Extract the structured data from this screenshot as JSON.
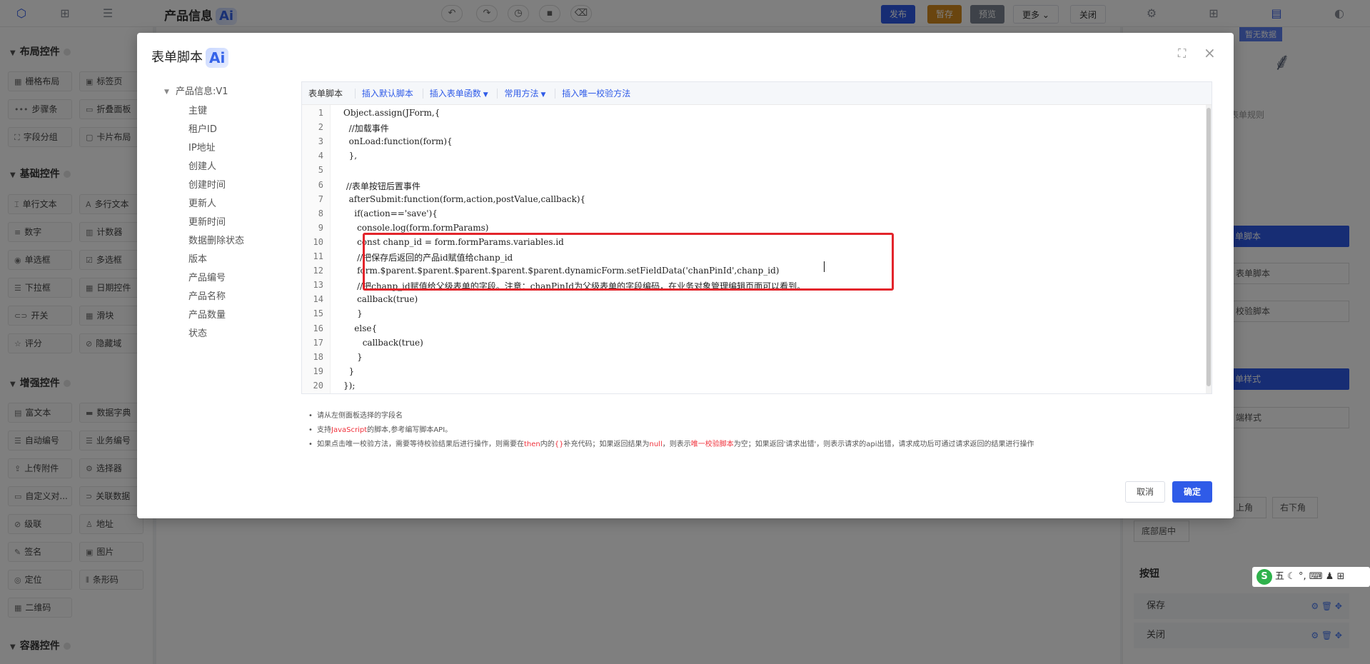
{
  "header": {
    "title": "产品信息",
    "ai_badge": "Ai",
    "actions": {
      "publish": "发布",
      "save_draft": "暂存",
      "preview": "预览",
      "more": "更多",
      "close": "关闭"
    }
  },
  "left_panel": {
    "sections": [
      {
        "title": "布局控件",
        "items": [
          "栅格布局",
          "标签页",
          "步骤条",
          "折叠面板",
          "字段分组",
          "卡片布局"
        ]
      },
      {
        "title": "基础控件",
        "items": [
          "单行文本",
          "多行文本",
          "数字",
          "计数器",
          "单选框",
          "多选框",
          "下拉框",
          "日期控件",
          "开关",
          "滑块",
          "评分",
          "隐藏域"
        ]
      },
      {
        "title": "增强控件",
        "items": [
          "富文本",
          "数据字典",
          "自动编号",
          "业务编号",
          "上传附件",
          "选择器",
          "自定义对...",
          "关联数据",
          "级联",
          "地址",
          "签名",
          "图片",
          "定位",
          "条形码",
          "二维码"
        ]
      },
      {
        "title": "容器控件",
        "items": []
      }
    ]
  },
  "right_panel": {
    "no_data": "暂无数据",
    "form_rules": "表单规则",
    "blue_buttons": [
      "单脚本",
      "单样式"
    ],
    "boxes": [
      "表单脚本",
      "校验脚本",
      "端样式"
    ],
    "position_buttons": [
      "上角",
      "右下角",
      "底部居中"
    ],
    "buttons_label": "按钮",
    "button_rows": [
      "保存",
      "关闭"
    ]
  },
  "modal": {
    "title": "表单脚本",
    "ai_badge": "Ai",
    "tree": {
      "root": "产品信息:V1",
      "fields": [
        "主键",
        "租户ID",
        "IP地址",
        "创建人",
        "创建时间",
        "更新人",
        "更新时间",
        "数据删除状态",
        "版本",
        "产品编号",
        "产品名称",
        "产品数量",
        "状态"
      ]
    },
    "toolbar": {
      "label": "表单脚本",
      "insert_default": "插入默认脚本",
      "insert_function": "插入表单函数",
      "common_methods": "常用方法",
      "insert_unique": "插入唯一校验方法"
    },
    "code_lines": [
      "Object.assign(JForm,{",
      "  //加载事件",
      "  onLoad:function(form){",
      "  },",
      "",
      " //表单按钮后置事件",
      "  afterSubmit:function(form,action,postValue,callback){",
      "    if(action=='save'){",
      "     console.log(form.formParams)",
      "     const chanp_id = form.formParams.variables.id",
      "     //把保存后返回的产品id赋值给chanp_id",
      "     form.$parent.$parent.$parent.$parent.$parent.dynamicForm.setFieldData('chanPinId',chanp_id)",
      "     //把chanp_id赋值给父级表单的字段。注意：chanPinId为父级表单的字段编码，在业务对象管理编辑页面可以看到。",
      "     callback(true)",
      "     }",
      "    else{",
      "       callback(true)",
      "     }",
      "  }",
      "});"
    ],
    "tips": {
      "tip1": "请从左侧面板选择的字段名",
      "tip2_a": "支持",
      "tip2_red": "JavaScript",
      "tip2_b": "的脚本,参考编写脚本API。",
      "tip3_a": "如果点击唯一校验方法，需要等待校验结果后进行操作，则需要在",
      "tip3_red1": "then",
      "tip3_b": "内的",
      "tip3_red2": "{}",
      "tip3_c": "补充代码；如果返回结果为",
      "tip3_red3": "null",
      "tip3_d": "，则表示",
      "tip3_red4": "唯一校验脚本",
      "tip3_e": "为空；如果返回'请求出错'，则表示请求的api出错，请求成功后可通过请求返回的结果进行操作"
    },
    "cancel": "取消",
    "confirm": "确定"
  },
  "ime": {
    "label": "五"
  },
  "colors": {
    "primary": "#2f5be8",
    "danger": "#e3242b",
    "draft": "#d48a1f",
    "preview": "#7d8592"
  }
}
